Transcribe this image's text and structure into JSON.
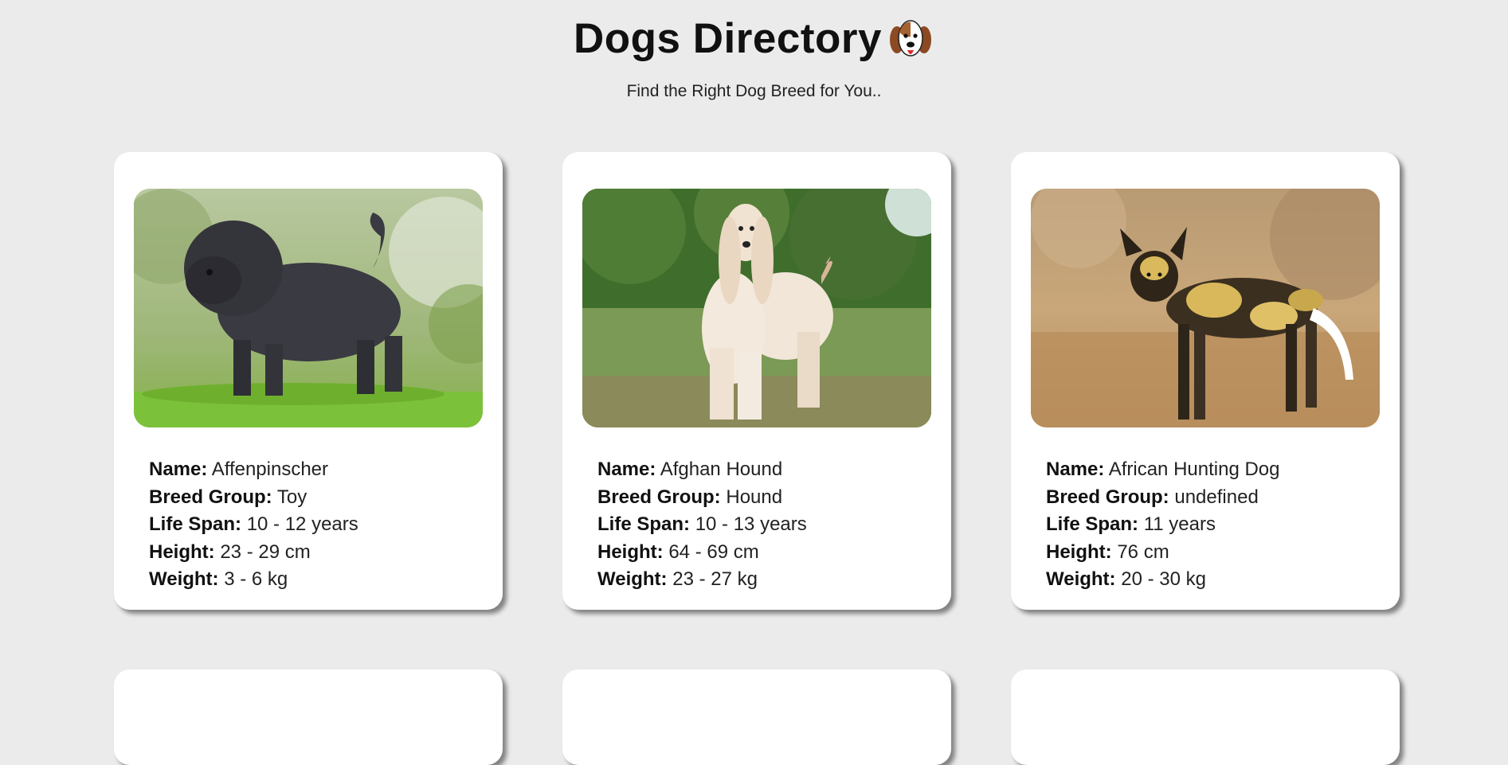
{
  "header": {
    "title": "Dogs Directory",
    "title_icon": "dog-face-icon",
    "subtitle": "Find the Right Dog Breed for You.."
  },
  "labels": {
    "name": "Name:",
    "breed_group": "Breed Group:",
    "life_span": "Life Span:",
    "height": "Height:",
    "weight": "Weight:"
  },
  "dogs": [
    {
      "name": "Affenpinscher",
      "breed_group": "Toy",
      "life_span": "10 - 12 years",
      "height": "23 - 29 cm",
      "weight": "3 - 6 kg",
      "image": "affenpinscher-photo"
    },
    {
      "name": "Afghan Hound",
      "breed_group": "Hound",
      "life_span": "10 - 13 years",
      "height": "64 - 69 cm",
      "weight": "23 - 27 kg",
      "image": "afghan-hound-photo"
    },
    {
      "name": "African Hunting Dog",
      "breed_group": "undefined",
      "life_span": "11 years",
      "height": "76 cm",
      "weight": "20 - 30 kg",
      "image": "african-hunting-dog-photo"
    }
  ],
  "colors": {
    "background": "#ebebeb",
    "card": "#ffffff",
    "text": "#111111"
  }
}
